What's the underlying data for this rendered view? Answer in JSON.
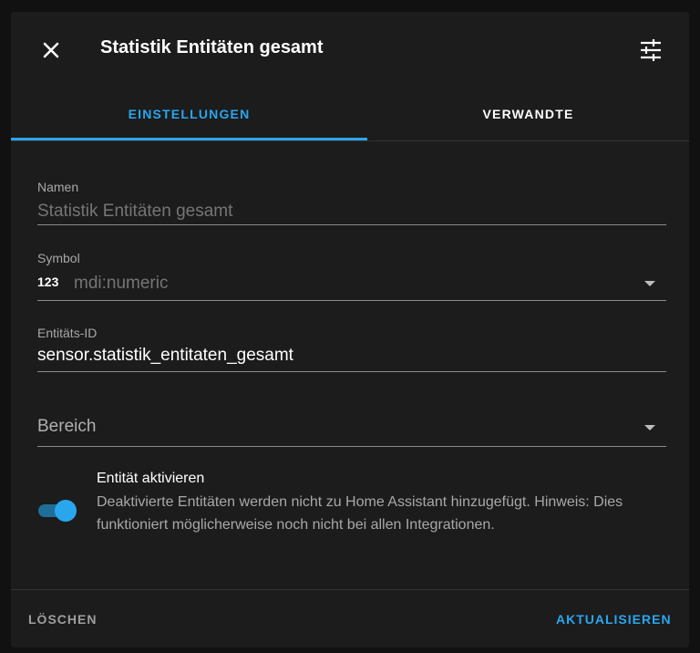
{
  "dialog": {
    "title": "Statistik Entitäten gesamt",
    "close_icon": "close-icon",
    "settings_icon": "tune-icon"
  },
  "tabs": [
    {
      "label": "EINSTELLUNGEN",
      "active": true
    },
    {
      "label": "VERWANDTE",
      "active": false
    }
  ],
  "form": {
    "name": {
      "label": "Namen",
      "placeholder": "Statistik Entitäten gesamt",
      "value": ""
    },
    "icon": {
      "label": "Symbol",
      "prefix_icon": "123",
      "placeholder": "mdi:numeric"
    },
    "entity_id": {
      "label": "Entitäts-ID",
      "value": "sensor.statistik_entitaten_gesamt"
    },
    "area": {
      "label": "Bereich"
    },
    "enable": {
      "label": "Entität aktivieren",
      "enabled": true,
      "description": "Deaktivierte Entitäten werden nicht zu Home Assistant hinzugefügt. Hinweis: Dies funktioniert möglicherweise noch nicht bei allen Integrationen."
    }
  },
  "footer": {
    "delete_label": "LÖSCHEN",
    "update_label": "AKTUALISIEREN"
  },
  "colors": {
    "accent": "#2aa6ee",
    "surface": "#1c1c1c",
    "backdrop": "#111111"
  }
}
